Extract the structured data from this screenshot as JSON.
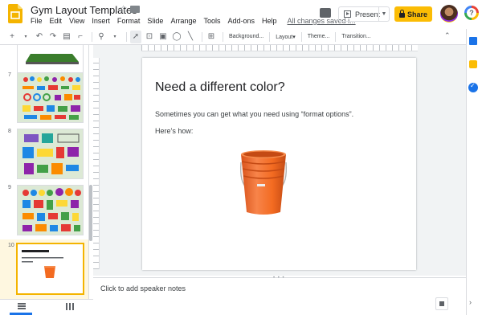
{
  "header": {
    "title": "Gym Layout Templates",
    "menu": [
      "File",
      "Edit",
      "View",
      "Insert",
      "Format",
      "Slide",
      "Arrange",
      "Tools",
      "Add-ons",
      "Help"
    ],
    "saved_status": "All changes saved i...",
    "present_label": "Present",
    "share_label": "Share",
    "help_glyph": "?"
  },
  "toolbar": {
    "background_label": "Background...",
    "layout_label": "Layout▾",
    "theme_label": "Theme...",
    "transition_label": "Transition..."
  },
  "filmstrip": {
    "slides": [
      {
        "number": "7"
      },
      {
        "number": "8"
      },
      {
        "number": "9"
      },
      {
        "number": "10",
        "selected": true
      }
    ]
  },
  "slide": {
    "title": "Need a different color?",
    "body_line1": "Sometimes you can get what you need using “format options”.",
    "body_line2": "Here’s how:",
    "image_icon": "orange-bucket"
  },
  "notes": {
    "placeholder": "Click to add speaker notes"
  },
  "colors": {
    "accent": "#fbbc04",
    "bucket": "#f36b21",
    "selection": "#f4b400",
    "link": "#1a73e8"
  }
}
